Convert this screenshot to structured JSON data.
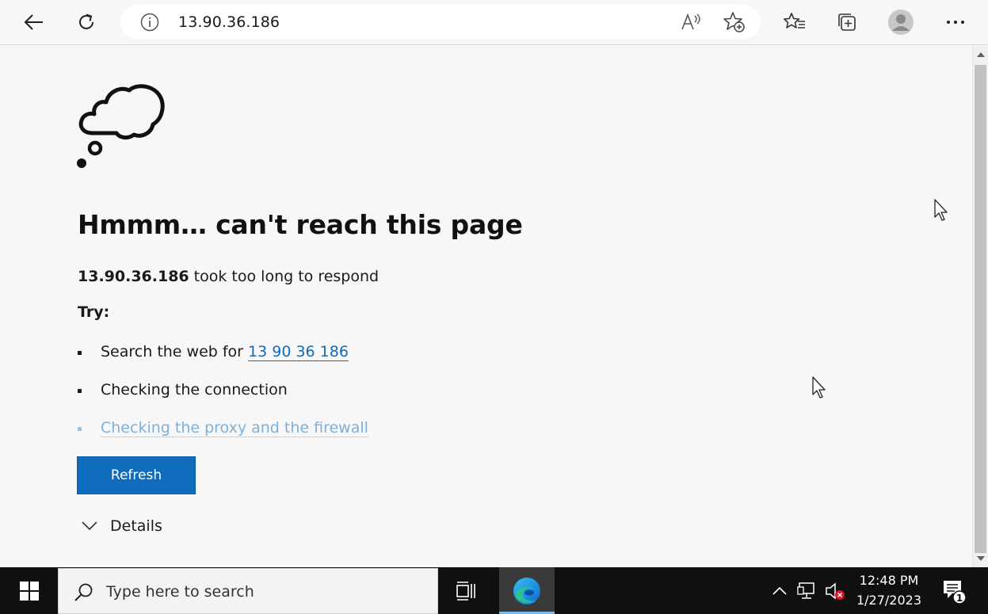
{
  "browser": {
    "address": "13.90.36.186",
    "icons": {
      "back": "back-arrow-icon",
      "refresh": "refresh-icon",
      "site_info": "info-icon",
      "read_aloud": "read-aloud-icon",
      "add_favorite": "add-favorite-icon",
      "favorites": "favorites-icon",
      "collections": "collections-icon",
      "profile": "profile-avatar-icon",
      "more": "more-options-icon"
    }
  },
  "page": {
    "heading": "Hmmm… can't reach this page",
    "message_host": "13.90.36.186",
    "message_rest": " took too long to respond",
    "try_label": "Try:",
    "suggestions": {
      "search_prefix": "Search the web for ",
      "search_link": "13 90 36 186",
      "connection": "Checking the connection",
      "proxy": "Checking the proxy and the firewall"
    },
    "refresh_button": "Refresh",
    "details_label": "Details"
  },
  "taskbar": {
    "search_placeholder": "Type here to search",
    "time": "12:48 PM",
    "date": "1/27/2023",
    "notification_count": "1"
  },
  "colors": {
    "accent": "#0f6cbd",
    "taskbar": "#101010",
    "page_background": "#f7f7f7"
  }
}
